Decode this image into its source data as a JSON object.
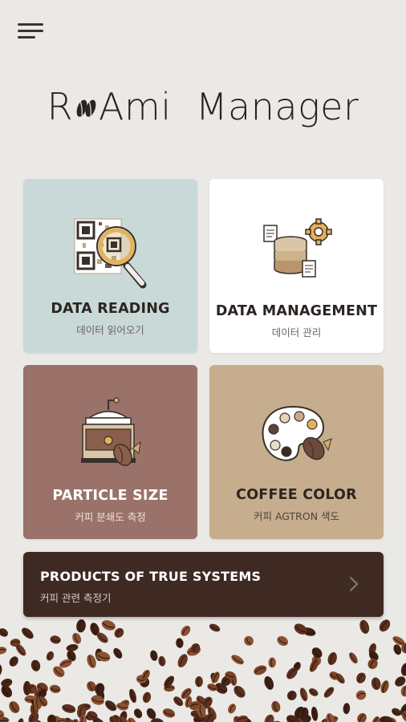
{
  "header": {
    "menu_icon": "hamburger-menu-icon",
    "title_part1": "R",
    "title_part2": "Ami",
    "title_part3": "Manager"
  },
  "cards": {
    "data_reading": {
      "title": "DATA READING",
      "subtitle": "데이터 읽어오기",
      "icon": "qr-magnifier-icon",
      "bg": "#c9d9d8"
    },
    "data_management": {
      "title": "DATA MANAGEMENT",
      "subtitle": "데이터 관리",
      "icon": "database-gear-icon",
      "bg": "#ffffff"
    },
    "particle_size": {
      "title": "PARTICLE SIZE",
      "subtitle": "커피 분쇄도 측정",
      "icon": "coffee-grinder-icon",
      "bg": "#9a7269"
    },
    "coffee_color": {
      "title": "COFFEE COLOR",
      "subtitle": "커피 AGTRON 색도",
      "icon": "color-palette-icon",
      "bg": "#c6ad8d"
    }
  },
  "banner": {
    "title": "PRODUCTS OF TRUE SYSTEMS",
    "subtitle": "커피 관련 측정기",
    "icon": "chevron-right-icon",
    "bg": "#3e2a23"
  },
  "colors": {
    "background": "#ebe9e6",
    "text_dark": "#2b2522"
  }
}
